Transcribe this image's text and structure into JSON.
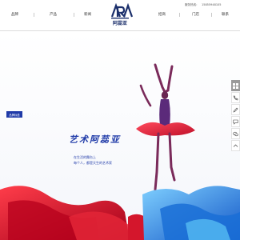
{
  "header": {
    "nav_left": [
      "品牌",
      "产品",
      "新闻"
    ],
    "nav_right": [
      "招商",
      "门店",
      "联系"
    ],
    "hotline_label": "服务热线：",
    "hotline_number": "15855948105",
    "logo_text": "阿蕊亚"
  },
  "hero": {
    "badge": "品牌标语",
    "title": "艺术阿蕊亚",
    "line1": "在生活的舞台上",
    "line2": "每个人，都是天生的艺术家"
  },
  "sidebar": {
    "icons": [
      "grid-icon",
      "phone-icon",
      "edit-icon",
      "chat-icon",
      "wechat-icon",
      "arrow-up-icon"
    ]
  },
  "colors": {
    "brand_blue": "#1f3aa8",
    "accent_red": "#d4162c",
    "accent_blue": "#2a8fd8",
    "sidebar_gray": "#9a9a9a"
  }
}
